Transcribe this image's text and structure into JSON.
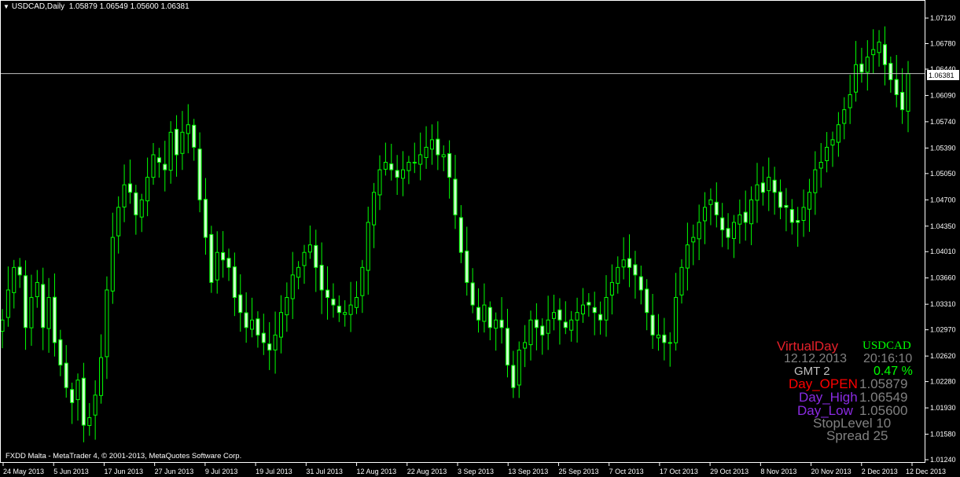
{
  "header": {
    "symbol": "USDCAD,Daily",
    "ohlc": "1.05879 1.06549 1.05600 1.06381"
  },
  "footer": {
    "copyright": "FXDD Malta - MetaTrader 4, © 2001-2013, MetaQuotes Software Corp."
  },
  "colors": {
    "background": "#000000",
    "axis": "#ffffff",
    "candle_outline": "#00ff00",
    "candle_up_fill": "#000000",
    "candle_down_fill": "#ccffcc",
    "bid_line": "#c0c0c0"
  },
  "price_scale": [
    "1.07120",
    "1.06780",
    "1.06440",
    "1.06090",
    "1.05740",
    "1.05390",
    "1.05050",
    "1.04700",
    "1.04350",
    "1.04010",
    "1.03660",
    "1.03310",
    "1.02970",
    "1.02620",
    "1.02280",
    "1.01930",
    "1.01580",
    "1.01240"
  ],
  "current_price_label": "1.06381",
  "date_labels": [
    "24 May 2013",
    "5 Jun 2013",
    "17 Jun 2013",
    "27 Jun 2013",
    "9 Jul 2013",
    "19 Jul 2013",
    "31 Jul 2013",
    "12 Aug 2013",
    "22 Aug 2013",
    "3 Sep 2013",
    "13 Sep 2013",
    "25 Sep 2013",
    "7 Oct 2013",
    "17 Oct 2013",
    "29 Oct 2013",
    "8 Nov 2013",
    "20 Nov 2013",
    "2 Dec 2013",
    "12 Dec 2013"
  ],
  "info_panel": {
    "title": "VirtualDay",
    "symbol": "USDCAD",
    "date": "12.12.2013",
    "time": "20:16:10",
    "gmt": "GMT 2",
    "change": "0.47 %",
    "open_label": "Day_OPEN",
    "open_value": "1.05879",
    "high_label": "Day_High",
    "high_value": "1.06549",
    "low_label": "Day_Low",
    "low_value": "1.05600",
    "stoplevel": "StopLevel  10",
    "spread": "Spread   25"
  },
  "chart_data": {
    "type": "candlestick",
    "symbol": "USDCAD",
    "timeframe": "Daily",
    "ylim": [
      1.0124,
      1.0712
    ],
    "current_price": 1.06381,
    "last_candle": {
      "open": 1.05879,
      "high": 1.06549,
      "low": 1.056,
      "close": 1.06381
    },
    "x_start_date": "24 May 2013",
    "x_end_date": "12 Dec 2013",
    "closes": [
      1.031,
      1.035,
      1.038,
      1.037,
      1.03,
      1.034,
      1.036,
      1.03,
      1.034,
      1.028,
      1.025,
      1.022,
      1.02,
      1.023,
      1.017,
      1.018,
      1.021,
      1.026,
      1.035,
      1.042,
      1.046,
      1.049,
      1.048,
      1.045,
      1.047,
      1.05,
      1.053,
      1.052,
      1.051,
      1.056,
      1.053,
      1.056,
      1.057,
      1.054,
      1.047,
      1.042,
      1.036,
      1.04,
      1.039,
      1.038,
      1.034,
      1.032,
      1.03,
      1.031,
      1.029,
      1.028,
      1.027,
      1.029,
      1.032,
      1.034,
      1.037,
      1.038,
      1.04,
      1.041,
      1.038,
      1.035,
      1.034,
      1.033,
      1.032,
      1.032,
      1.033,
      1.034,
      1.038,
      1.044,
      1.048,
      1.051,
      1.052,
      1.051,
      1.05,
      1.051,
      1.052,
      1.052,
      1.053,
      1.054,
      1.055,
      1.053,
      1.053,
      1.05,
      1.045,
      1.04,
      1.036,
      1.033,
      1.031,
      1.033,
      1.03,
      1.031,
      1.03,
      1.025,
      1.022,
      1.027,
      1.028,
      1.031,
      1.03,
      1.029,
      1.031,
      1.032,
      1.031,
      1.03,
      1.031,
      1.032,
      1.033,
      1.033,
      1.032,
      1.031,
      1.034,
      1.036,
      1.038,
      1.039,
      1.038,
      1.037,
      1.035,
      1.032,
      1.029,
      1.029,
      1.028,
      1.028,
      1.034,
      1.038,
      1.041,
      1.042,
      1.044,
      1.046,
      1.047,
      1.045,
      1.043,
      1.042,
      1.044,
      1.045,
      1.044,
      1.047,
      1.049,
      1.048,
      1.05,
      1.048,
      1.046,
      1.046,
      1.044,
      1.044,
      1.046,
      1.048,
      1.051,
      1.052,
      1.054,
      1.055,
      1.057,
      1.059,
      1.061,
      1.065,
      1.064,
      1.066,
      1.067,
      1.068,
      1.065,
      1.063,
      1.061,
      1.059,
      1.0638
    ]
  }
}
